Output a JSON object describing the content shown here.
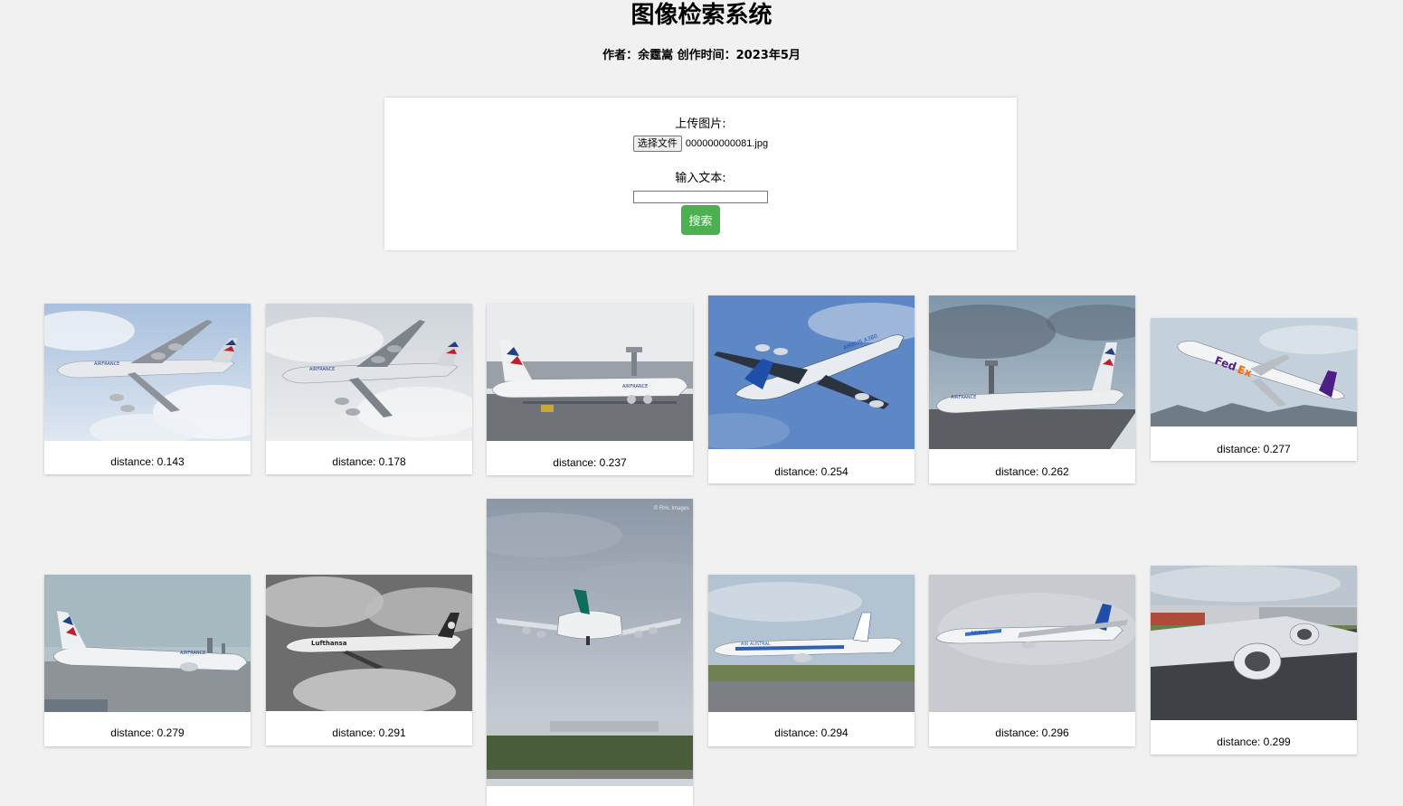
{
  "header": {
    "title": "图像检索系统",
    "subtitle": "作者：余霆嵩 创作时间：2023年5月"
  },
  "form": {
    "upload_label": "上传图片:",
    "choose_file_button": "选择文件",
    "file_name": "000000000081.jpg",
    "text_label": "输入文本:",
    "text_value": "",
    "search_button": "搜索"
  },
  "results": [
    {
      "caption": "distance: 0.143",
      "scene": "airfrance-a380-sky"
    },
    {
      "caption": "distance: 0.178",
      "scene": "airfrance-a380-sky"
    },
    {
      "caption": "distance: 0.237",
      "scene": "airfrance-a380-airport"
    },
    {
      "caption": "distance: 0.254",
      "scene": "airbus-a380-blue-sky"
    },
    {
      "caption": "distance: 0.262",
      "scene": "airfrance-747-airport"
    },
    {
      "caption": "distance: 0.277",
      "scene": "fedex-md11-takeoff"
    },
    {
      "caption": "distance: 0.279",
      "scene": "airfrance-777-tarmac"
    },
    {
      "caption": "distance: 0.291",
      "scene": "lufthansa-747-bw"
    },
    {
      "caption": "",
      "scene": "cathay-747-landing",
      "watermark": "© RHL Images"
    },
    {
      "caption": "distance: 0.294",
      "scene": "air-austral-777-runway"
    },
    {
      "caption": "distance: 0.296",
      "scene": "airbus-a350-flying"
    },
    {
      "caption": "distance: 0.299",
      "scene": "a380-wing-engine"
    }
  ],
  "colors": {
    "background": "#f1f1f1",
    "search_button": "#4caf50",
    "card": "#ffffff"
  }
}
